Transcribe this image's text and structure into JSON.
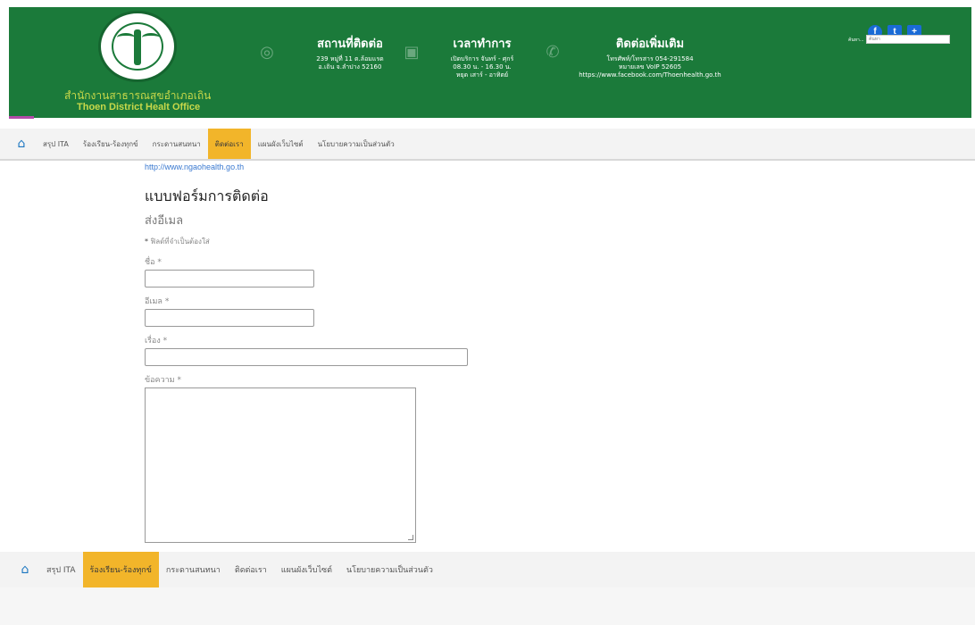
{
  "header": {
    "org_th": "สำนักงานสาธารณสุขอำเภอเถิน",
    "org_en": "Thoen District Healt Office",
    "location": {
      "title": "สถานที่ติดต่อ",
      "line1": "239 หมู่ที่ 11 ต.ล้อมแรด",
      "line2": "อ.เถิน จ.ลำปาง 52160"
    },
    "hours": {
      "title": "เวลาทำการ",
      "line1": "เปิดบริการ จันทร์ - ศุกร์",
      "line2": "08.30 น. - 16.30 น.",
      "line3": "หยุด เสาร์ - อาทิตย์"
    },
    "contact": {
      "title": "ติดต่อเพิ่มเติม",
      "line1": "โทรศัพท์/โทรสาร 054-291584",
      "line2": "หมายเลข VoIP 52605",
      "line3": "https://www.facebook.com/Thoenhealth.go.th"
    },
    "social": {
      "facebook": "f",
      "twitter": "t",
      "plus": "+"
    },
    "search_label": "ค้นหา...",
    "search_placeholder": "ค้นหา",
    "colors": {
      "header_bg": "#1b7a3a",
      "org_text": "#c8d84a",
      "nav_active": "#f2b52a",
      "link": "#3b7ad0"
    }
  },
  "nav_top": {
    "items": [
      "สรุป ITA",
      "ร้องเรียน-ร้องทุกข์",
      "กระดานสนทนา",
      "ติดต่อเรา",
      "แผนผังเว็บไซต์",
      "นโยบายความเป็นส่วนตัว"
    ],
    "active": "ติดต่อเรา"
  },
  "nav_bottom": {
    "items": [
      "สรุป ITA",
      "ร้องเรียน-ร้องทุกข์",
      "กระดานสนทนา",
      "ติดต่อเรา",
      "แผนผังเว็บไซต์",
      "นโยบายความเป็นส่วนตัว"
    ],
    "active": "ร้องเรียน-ร้องทุกข์"
  },
  "content": {
    "url": "http://www.ngaohealth.go.th",
    "form_title": "แบบฟอร์มการติดต่อ",
    "form_subtitle": "ส่งอีเมล",
    "required_note": "ฟิลด์ที่จำเป็นต้องใส่",
    "fields": {
      "name": "ชื่อ",
      "email": "อีเมล",
      "subject": "เรื่อง",
      "message": "ข้อความ"
    },
    "required_mark": "*"
  }
}
